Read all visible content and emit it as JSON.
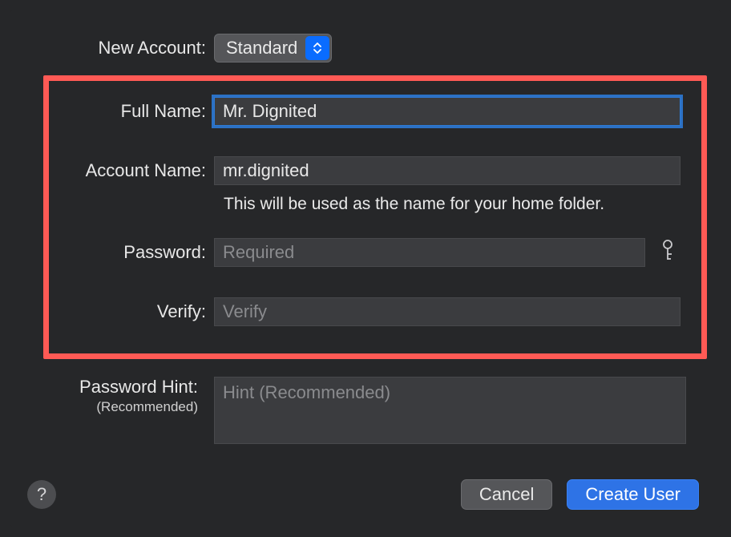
{
  "labels": {
    "new_account": "New Account:",
    "full_name": "Full Name:",
    "account_name": "Account Name:",
    "password": "Password:",
    "verify": "Verify:",
    "password_hint": "Password Hint:",
    "password_hint_sub": "(Recommended)"
  },
  "new_account": {
    "selected": "Standard"
  },
  "full_name": {
    "value": "Mr. Dignited"
  },
  "account_name": {
    "value": "mr.dignited",
    "helper": "This will be used as the name for your home folder."
  },
  "password": {
    "placeholder": "Required"
  },
  "verify": {
    "placeholder": "Verify"
  },
  "hint": {
    "placeholder": "Hint (Recommended)"
  },
  "buttons": {
    "help": "?",
    "cancel": "Cancel",
    "create": "Create User"
  }
}
